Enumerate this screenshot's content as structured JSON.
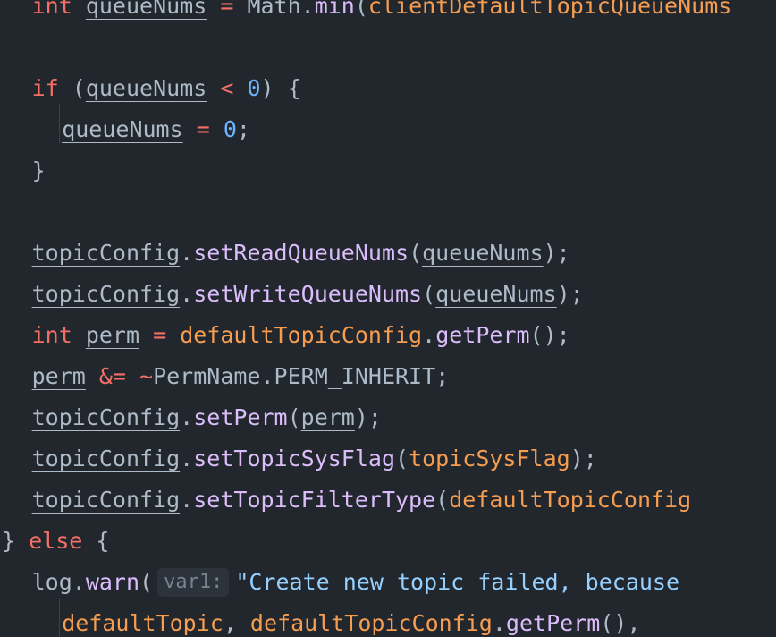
{
  "editor": {
    "lines": [
      {
        "indent": 2,
        "tokens": [
          {
            "k": "kw",
            "t": "int "
          },
          {
            "k": "var",
            "t": "queueNums"
          },
          {
            "k": "op",
            "t": " = "
          },
          {
            "k": "plain",
            "t": "Math."
          },
          {
            "k": "fn",
            "t": "min"
          },
          {
            "k": "plain",
            "t": "("
          },
          {
            "k": "field",
            "t": "clientDefaultTopicQueueNums"
          }
        ]
      },
      {
        "indent": 0,
        "tokens": []
      },
      {
        "indent": 2,
        "tokens": [
          {
            "k": "kw",
            "t": "if"
          },
          {
            "k": "plain",
            "t": " ("
          },
          {
            "k": "var",
            "t": "queueNums"
          },
          {
            "k": "op",
            "t": " < "
          },
          {
            "k": "num",
            "t": "0"
          },
          {
            "k": "plain",
            "t": ") {"
          }
        ]
      },
      {
        "indent": 4,
        "tokens": [
          {
            "k": "var",
            "t": "queueNums"
          },
          {
            "k": "op",
            "t": " = "
          },
          {
            "k": "num",
            "t": "0"
          },
          {
            "k": "plain",
            "t": ";"
          }
        ]
      },
      {
        "indent": 2,
        "tokens": [
          {
            "k": "plain",
            "t": "}"
          }
        ]
      },
      {
        "indent": 0,
        "tokens": []
      },
      {
        "indent": 2,
        "tokens": [
          {
            "k": "var",
            "t": "topicConfig"
          },
          {
            "k": "plain",
            "t": "."
          },
          {
            "k": "fn",
            "t": "setReadQueueNums"
          },
          {
            "k": "plain",
            "t": "("
          },
          {
            "k": "var",
            "t": "queueNums"
          },
          {
            "k": "plain",
            "t": ");"
          }
        ]
      },
      {
        "indent": 2,
        "tokens": [
          {
            "k": "var",
            "t": "topicConfig"
          },
          {
            "k": "plain",
            "t": "."
          },
          {
            "k": "fn",
            "t": "setWriteQueueNums"
          },
          {
            "k": "plain",
            "t": "("
          },
          {
            "k": "var",
            "t": "queueNums"
          },
          {
            "k": "plain",
            "t": ");"
          }
        ]
      },
      {
        "indent": 2,
        "tokens": [
          {
            "k": "kw",
            "t": "int "
          },
          {
            "k": "var",
            "t": "perm"
          },
          {
            "k": "op",
            "t": " = "
          },
          {
            "k": "field",
            "t": "defaultTopicConfig"
          },
          {
            "k": "plain",
            "t": "."
          },
          {
            "k": "fn",
            "t": "getPerm"
          },
          {
            "k": "plain",
            "t": "();"
          }
        ]
      },
      {
        "indent": 2,
        "tokens": [
          {
            "k": "var",
            "t": "perm"
          },
          {
            "k": "op",
            "t": " &= ~"
          },
          {
            "k": "plain",
            "t": "PermName.PERM_INHERIT;"
          }
        ]
      },
      {
        "indent": 2,
        "tokens": [
          {
            "k": "var",
            "t": "topicConfig"
          },
          {
            "k": "plain",
            "t": "."
          },
          {
            "k": "fn",
            "t": "setPerm"
          },
          {
            "k": "plain",
            "t": "("
          },
          {
            "k": "var",
            "t": "perm"
          },
          {
            "k": "plain",
            "t": ");"
          }
        ]
      },
      {
        "indent": 2,
        "tokens": [
          {
            "k": "var",
            "t": "topicConfig"
          },
          {
            "k": "plain",
            "t": "."
          },
          {
            "k": "fn",
            "t": "setTopicSysFlag"
          },
          {
            "k": "plain",
            "t": "("
          },
          {
            "k": "field",
            "t": "topicSysFlag"
          },
          {
            "k": "plain",
            "t": ");"
          }
        ]
      },
      {
        "indent": 2,
        "tokens": [
          {
            "k": "var",
            "t": "topicConfig"
          },
          {
            "k": "plain",
            "t": "."
          },
          {
            "k": "fn",
            "t": "setTopicFilterType"
          },
          {
            "k": "plain",
            "t": "("
          },
          {
            "k": "field",
            "t": "defaultTopicConfig"
          }
        ]
      },
      {
        "indent": 0,
        "tokens": [
          {
            "k": "plain",
            "t": "} "
          },
          {
            "k": "kw",
            "t": "else"
          },
          {
            "k": "plain",
            "t": " {"
          }
        ]
      },
      {
        "indent": 2,
        "tokens": [
          {
            "k": "plain",
            "t": "log."
          },
          {
            "k": "fn",
            "t": "warn"
          },
          {
            "k": "plain",
            "t": "("
          },
          {
            "k": "hint",
            "t": "var1:"
          },
          {
            "k": "str",
            "t": "\"Create new topic failed, because"
          }
        ]
      },
      {
        "indent": 4,
        "tokens": [
          {
            "k": "field",
            "t": "defaultTopic"
          },
          {
            "k": "plain",
            "t": ", "
          },
          {
            "k": "field",
            "t": "defaultTopicConfig"
          },
          {
            "k": "plain",
            "t": "."
          },
          {
            "k": "fn",
            "t": "getPerm"
          },
          {
            "k": "plain",
            "t": "(), "
          }
        ]
      }
    ]
  }
}
